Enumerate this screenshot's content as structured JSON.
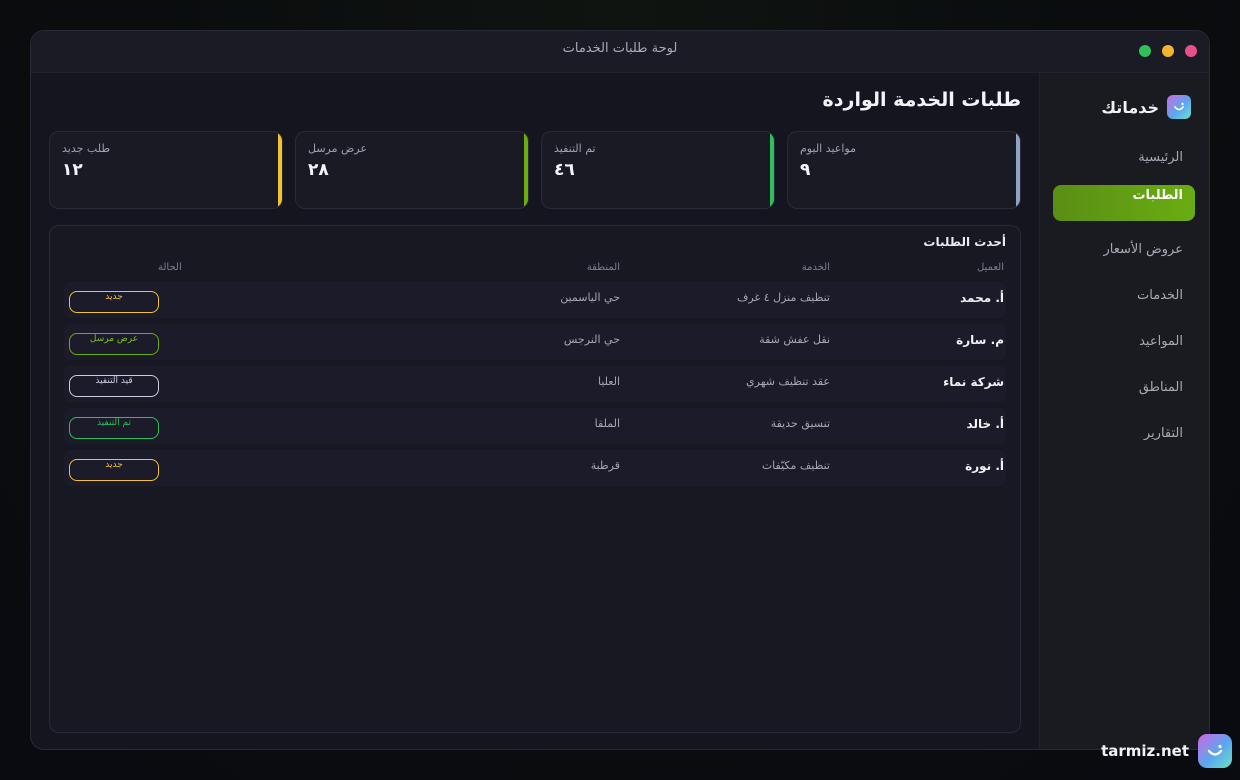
{
  "window": {
    "title": "لوحة طلبات الخدمات"
  },
  "brand": {
    "name": "خدماتك"
  },
  "nav": [
    {
      "label": "الرئيسية",
      "active": false
    },
    {
      "label": "الطلبات",
      "active": true
    },
    {
      "label": "عروض الأسعار",
      "active": false
    },
    {
      "label": "الخدمات",
      "active": false
    },
    {
      "label": "المواعيد",
      "active": false
    },
    {
      "label": "المناطق",
      "active": false
    },
    {
      "label": "التقارير",
      "active": false
    }
  ],
  "page": {
    "title": "طلبات الخدمة الواردة"
  },
  "stats": [
    {
      "label": "مواعيد اليوم",
      "value": "٩",
      "color": "#8fa3c6"
    },
    {
      "label": "تم التنفيذ",
      "value": "٤٦",
      "color": "#2fbf5b"
    },
    {
      "label": "عرض مرسل",
      "value": "٢٨",
      "color": "#6aad12"
    },
    {
      "label": "طلب جديد",
      "value": "١٢",
      "color": "#f2c230"
    }
  ],
  "table": {
    "title": "أحدث الطلبات",
    "headers": {
      "client": "العميل",
      "service": "الخدمة",
      "area": "المنطقة",
      "status": "الحالة"
    },
    "rows": [
      {
        "client": "أ. محمد",
        "service": "تنظيف منزل ٤ غرف",
        "area": "حي الياسمين",
        "status": "جديد",
        "status_color": "#f2c230"
      },
      {
        "client": "م. سارة",
        "service": "نقل عفش شقة",
        "area": "حي النرجس",
        "status": "عرض مرسل",
        "status_color": "#6aad12"
      },
      {
        "client": "شركة نماء",
        "service": "عقد تنظيف شهري",
        "area": "العليا",
        "status": "قيد التنفيذ",
        "status_color": "#c9cde0"
      },
      {
        "client": "أ. خالد",
        "service": "تنسيق حديقة",
        "area": "الملقا",
        "status": "تم التنفيذ",
        "status_color": "#2fbf5b"
      },
      {
        "client": "أ. نورة",
        "service": "تنظيف مكيّفات",
        "area": "قرطبة",
        "status": "جديد",
        "status_color": "#f2c230"
      }
    ]
  },
  "footer": {
    "text": "tarmiz.net"
  },
  "window_controls": [
    {
      "name": "close-dot",
      "color": "#e8508a"
    },
    {
      "name": "minimize-dot",
      "color": "#f2b530"
    },
    {
      "name": "maximize-dot",
      "color": "#2fbf5b"
    }
  ]
}
